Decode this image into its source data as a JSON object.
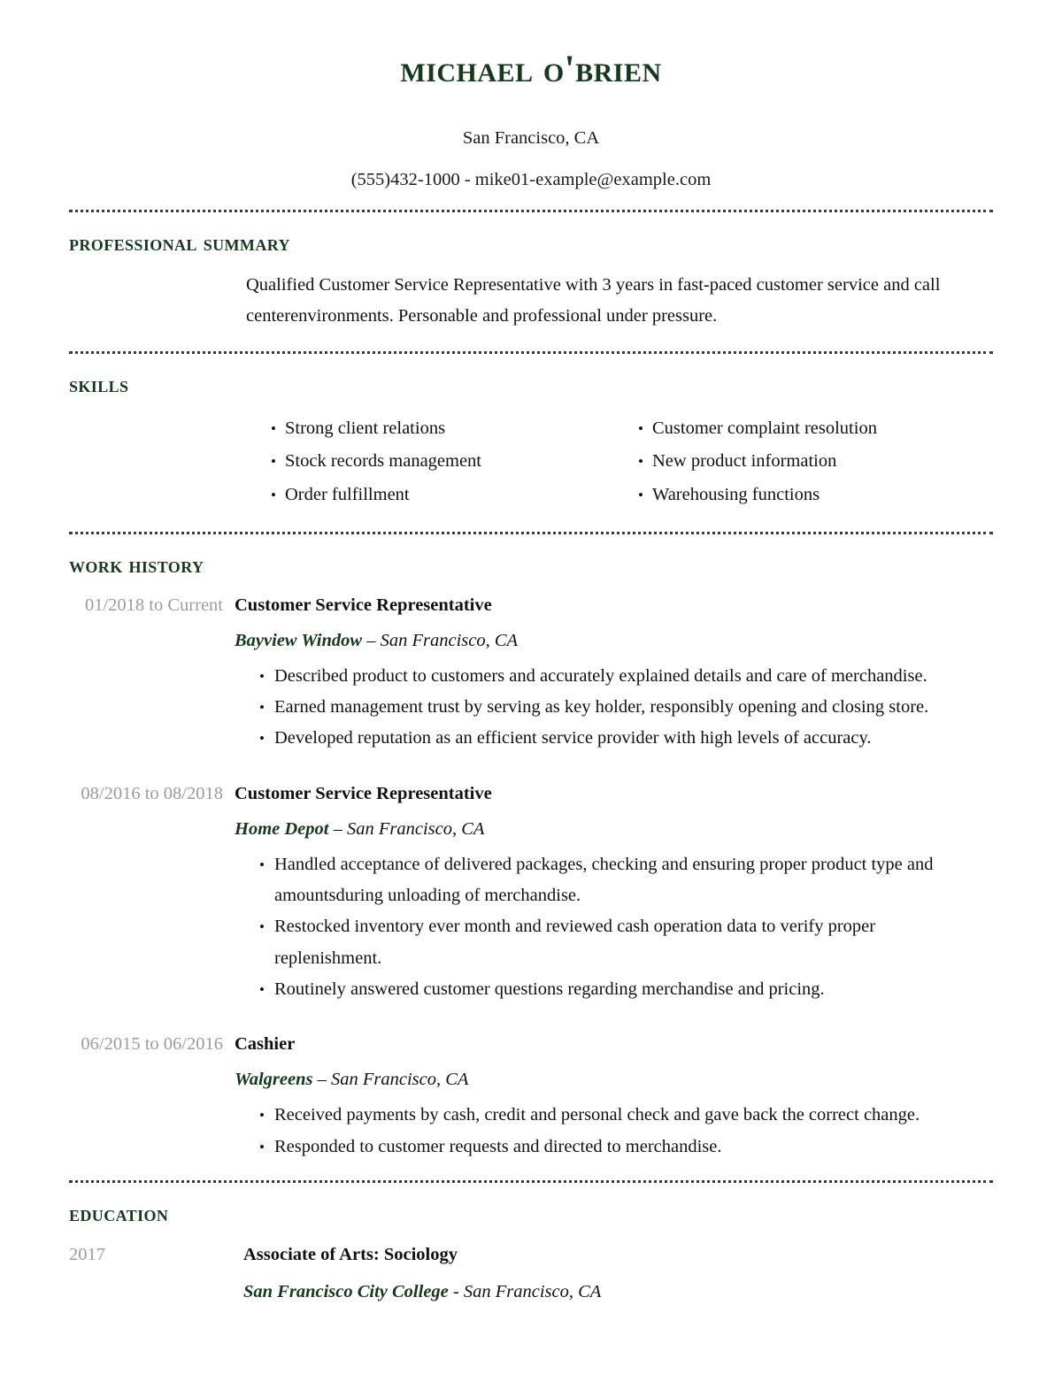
{
  "header": {
    "name": "Michael O'brien",
    "location": "San Francisco, CA",
    "contact": "(555)432-1000 - mike01-example@example.com"
  },
  "sections": {
    "summary_title": "Professional Summary",
    "skills_title": "Skills",
    "work_title": "Work History",
    "education_title": "Education"
  },
  "summary": {
    "text": "Qualified Customer Service Representative with 3 years in fast-paced customer service and call centerenvironments. Personable and professional under pressure."
  },
  "skills": {
    "bullet_glyph": "•",
    "items": [
      "Strong client relations",
      "Customer complaint resolution",
      "Stock records management",
      "New product information",
      "Order fulfillment",
      "Warehousing functions"
    ]
  },
  "work_history": {
    "bullet_glyph": "•",
    "jobs": [
      {
        "dates": "01/2018 to Current",
        "title": "Customer Service Representative",
        "company": "Bayview Window",
        "separator": "–",
        "location": "San Francisco, CA",
        "bullets": [
          "Described product to customers and accurately explained details and care of merchandise.",
          "Earned management trust by serving as key holder, responsibly opening and closing store.",
          "Developed reputation as an efficient service provider with high levels of accuracy."
        ]
      },
      {
        "dates": "08/2016 to 08/2018",
        "title": "Customer Service Representative",
        "company": "Home Depot",
        "separator": "–",
        "location": "San Francisco, CA",
        "bullets": [
          "Handled acceptance of delivered packages, checking and ensuring proper product type and amountsduring unloading of merchandise.",
          "Restocked inventory ever month and reviewed cash operation data to verify proper replenishment.",
          "Routinely answered customer questions regarding merchandise and pricing."
        ]
      },
      {
        "dates": "06/2015 to 06/2016",
        "title": "Cashier",
        "company": "Walgreens",
        "separator": "–",
        "location": "San Francisco, CA",
        "bullets": [
          "Received payments by cash, credit and personal check and gave back the correct change.",
          "Responded to customer requests and directed to merchandise."
        ]
      }
    ]
  },
  "education": {
    "entries": [
      {
        "year": "2017",
        "degree": "Associate of Arts: Sociology",
        "school": "San Francisco City College",
        "separator": "-",
        "location": "San Francisco, CA"
      }
    ]
  },
  "colors": {
    "accent_green": "#15391c",
    "muted_gray": "#9b9b9b",
    "body_text": "#111111",
    "divider": "#3a3a3a"
  }
}
